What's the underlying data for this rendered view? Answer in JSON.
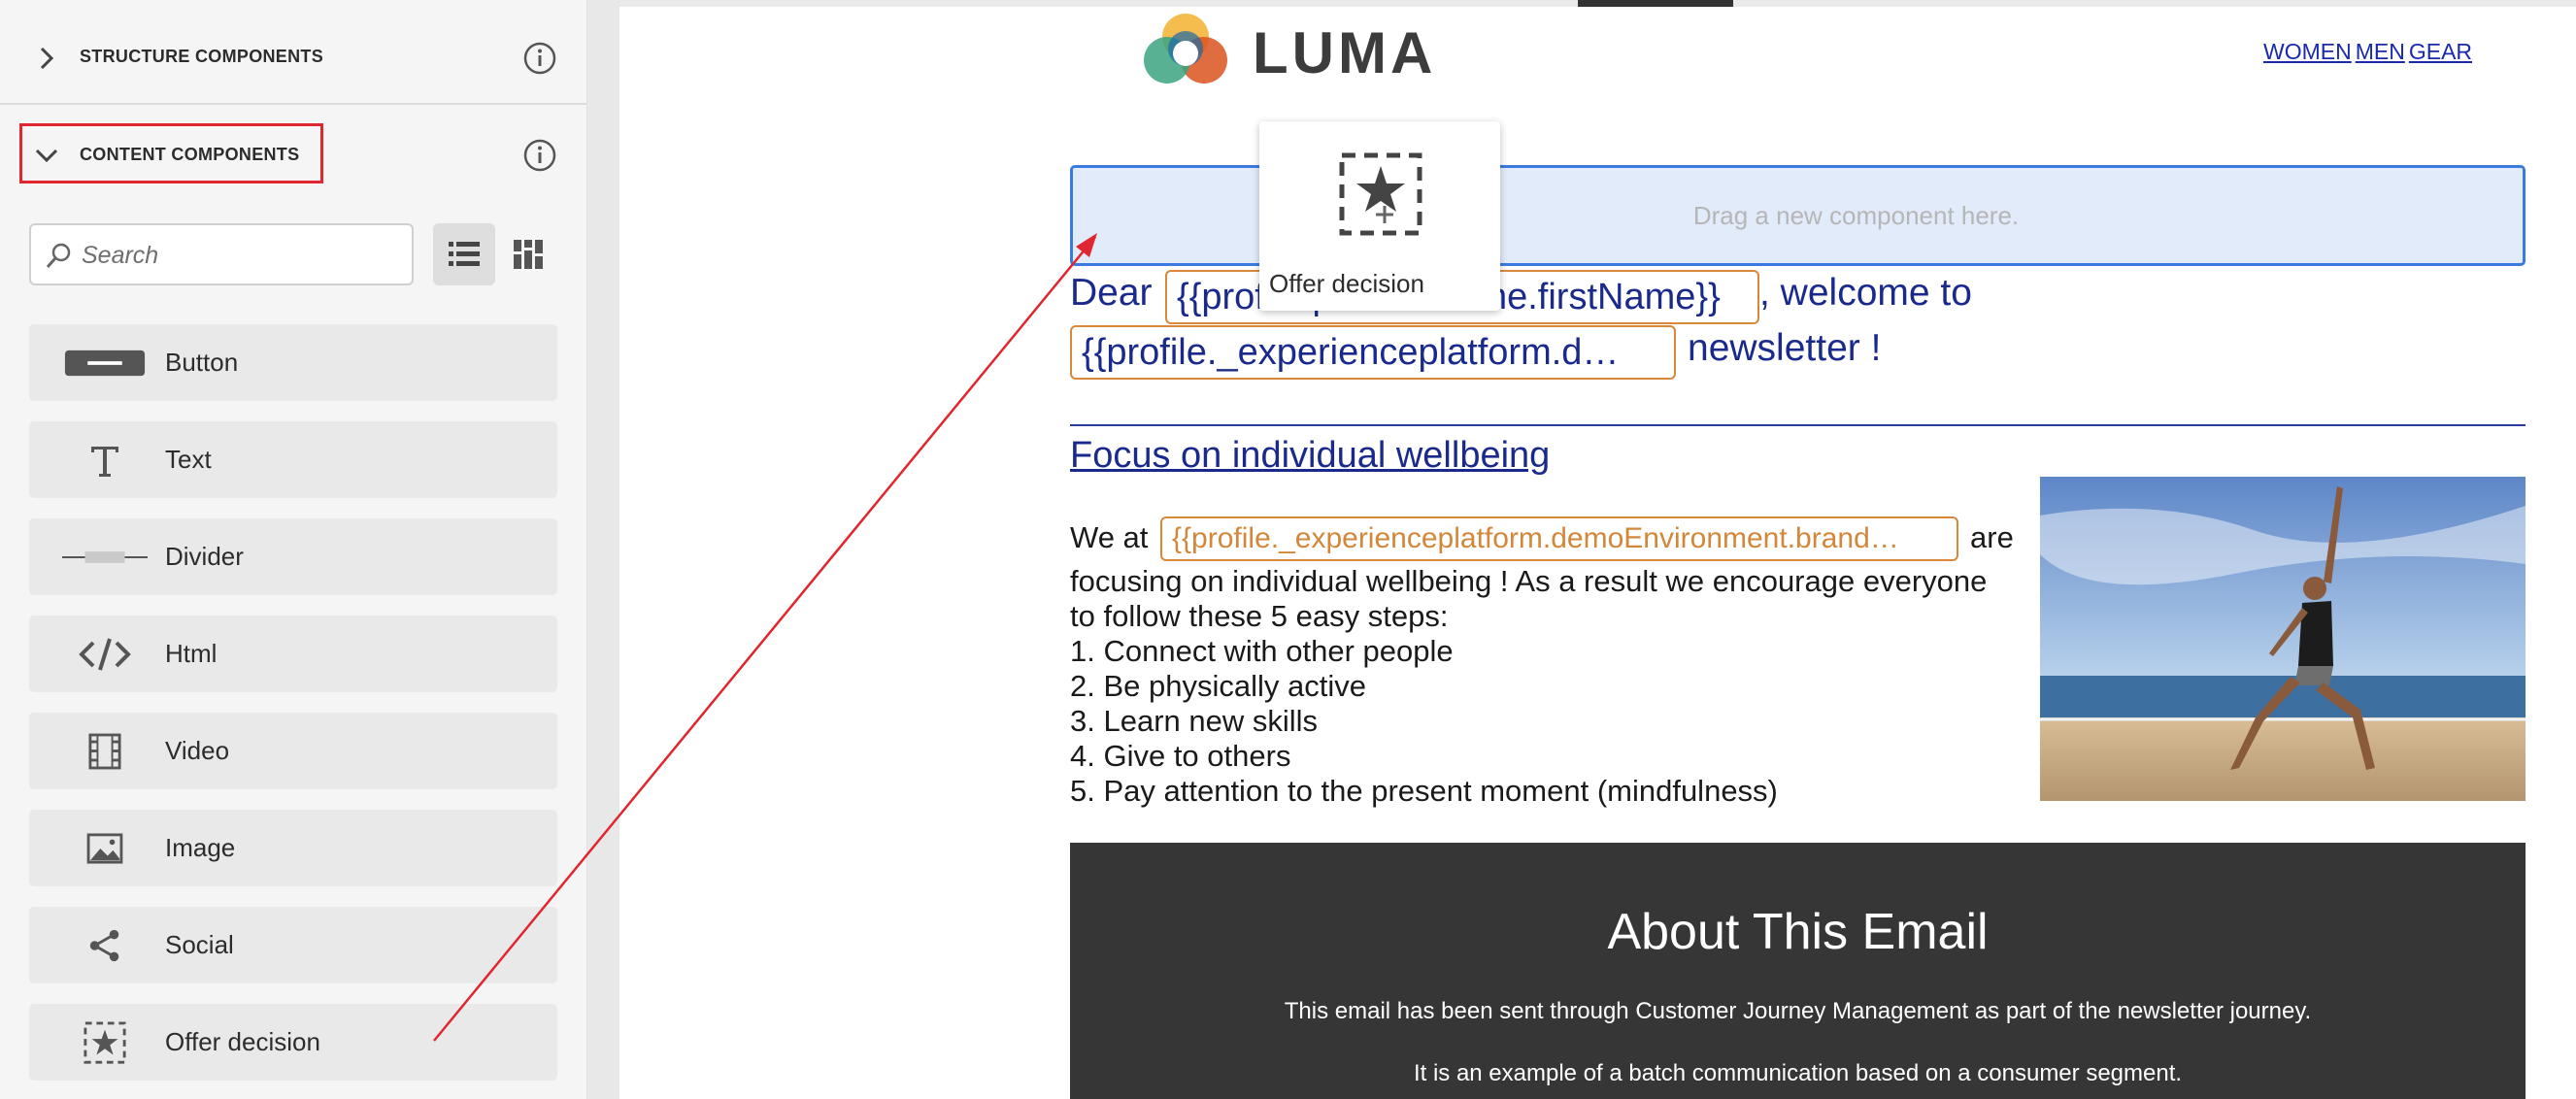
{
  "sidebar": {
    "structure_title": "STRUCTURE COMPONENTS",
    "content_title": "CONTENT COMPONENTS",
    "search_placeholder": "Search",
    "items": [
      {
        "label": "Button",
        "icon": "button-icon"
      },
      {
        "label": "Text",
        "icon": "text-icon"
      },
      {
        "label": "Divider",
        "icon": "divider-icon"
      },
      {
        "label": "Html",
        "icon": "code-icon"
      },
      {
        "label": "Video",
        "icon": "film-icon"
      },
      {
        "label": "Image",
        "icon": "image-icon"
      },
      {
        "label": "Social",
        "icon": "share-icon"
      },
      {
        "label": "Offer decision",
        "icon": "offer-decision-icon"
      }
    ]
  },
  "email": {
    "logo_text": "LUMA",
    "nav": [
      "WOMEN",
      "MEN",
      "GEAR"
    ],
    "drop_zone_text": "Drag a new component here.",
    "drag_ghost_label": "Offer decision",
    "greeting_dear": "Dear",
    "greeting_token_1": "{{profile.person.name.firstName}}",
    "greeting_welcome": ", welcome to",
    "greeting_token_2": "{{profile._experienceplatform.d…",
    "greeting_newsletter": "newsletter !",
    "focus_title": "Focus on individual wellbeing ",
    "we_at": "We at",
    "brand_token": "{{profile._experienceplatform.demoEnvironment.brand…",
    "are": "are",
    "body_lines": [
      "focusing on individual wellbeing ! As a result we encourage everyone",
      "to follow these 5 easy steps:",
      "1. Connect with other people",
      "2. Be physically active",
      "3. Learn new skills",
      "4. Give to others",
      "5. Pay attention to the present moment (mindfulness)"
    ],
    "footer_title": "About This Email",
    "footer_lines": [
      "This email has been sent through Customer Journey Management as part of the newsletter journey.",
      "It is an example of a batch communication based on a consumer segment."
    ]
  },
  "colors": {
    "highlight": "#e0262f",
    "link": "#1a2aaa",
    "token_border": "#d9883a",
    "drop_zone_border": "#3b7be0",
    "footer_bg": "#363636"
  }
}
